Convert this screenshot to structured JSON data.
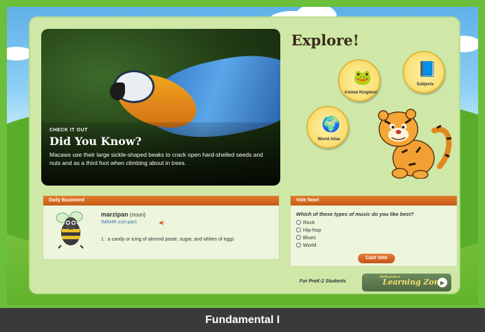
{
  "hero": {
    "kicker": "CHECK IT OUT",
    "title": "Did You Know?",
    "text": "Macaws use their large sickle-shaped beaks to crack open hard-shelled seeds and nuts and as a third foot when climbing about in trees."
  },
  "explore": {
    "title": "Explore!",
    "badges": [
      {
        "label": "Animal Kingdom",
        "icon": "frog-icon"
      },
      {
        "label": "Subjects",
        "icon": "book-icon"
      },
      {
        "label": "World Atlas",
        "icon": "globe-icon"
      }
    ]
  },
  "buzzword": {
    "header": "Daily Buzzword",
    "word": "marzipan",
    "pos": "(noun)",
    "pronunciation": "\\MAHR-zuh-pan\\",
    "definition": "1 : a candy or icing of almond paste, sugar, and whites of eggs"
  },
  "vote": {
    "header": "Vote Now!",
    "question": "Which of these types of music do you like best?",
    "options": [
      "Rock",
      "Hip-hop",
      "Blues",
      "World"
    ],
    "button": "Cast Vote"
  },
  "footer": {
    "prek_text": "For PreK-2 Students",
    "lz_small": "Britannica",
    "lz_title": "Learning Zone"
  },
  "label_bar": "Fundamental I",
  "colors": {
    "accent_orange": "#d0621f",
    "grass_green": "#6bbf3a",
    "panel_bg": "#edf5dc"
  }
}
